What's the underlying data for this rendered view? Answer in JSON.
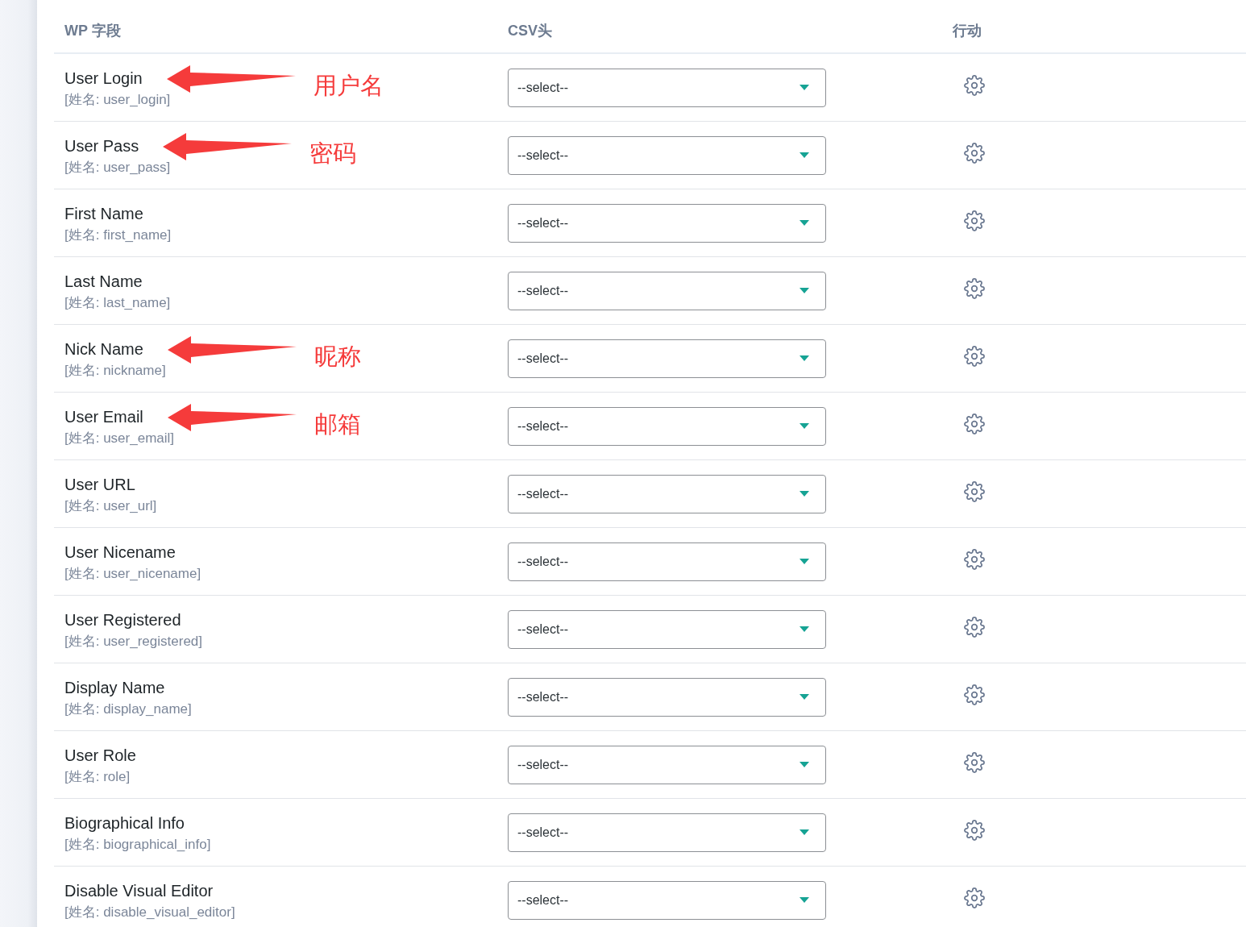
{
  "columns": [
    {
      "label": "WP 字段"
    },
    {
      "label": "CSV头"
    },
    {
      "label": "行动"
    }
  ],
  "rows": [
    {
      "name": "User Login",
      "key": "[姓名: user_login]",
      "csv": {
        "value": "--select--"
      },
      "annotation": "用户名"
    },
    {
      "name": "User Pass",
      "key": "[姓名: user_pass]",
      "csv": {
        "value": "--select--"
      },
      "annotation": "密码"
    },
    {
      "name": "First Name",
      "key": "[姓名: first_name]",
      "csv": {
        "value": "--select--"
      }
    },
    {
      "name": "Last Name",
      "key": "[姓名: last_name]",
      "csv": {
        "value": "--select--"
      }
    },
    {
      "name": "Nick Name",
      "key": "[姓名: nickname]",
      "csv": {
        "value": "--select--"
      },
      "annotation": "昵称"
    },
    {
      "name": "User Email",
      "key": "[姓名: user_email]",
      "csv": {
        "value": "--select--"
      },
      "annotation": "邮箱"
    },
    {
      "name": "User URL",
      "key": "[姓名: user_url]",
      "csv": {
        "value": "--select--"
      }
    },
    {
      "name": "User Nicename",
      "key": "[姓名: user_nicename]",
      "csv": {
        "value": "--select--"
      }
    },
    {
      "name": "User Registered",
      "key": "[姓名: user_registered]",
      "csv": {
        "value": "--select--"
      }
    },
    {
      "name": "Display Name",
      "key": "[姓名: display_name]",
      "csv": {
        "value": "--select--"
      }
    },
    {
      "name": "User Role",
      "key": "[姓名: role]",
      "csv": {
        "value": "--select--"
      }
    },
    {
      "name": "Biographical Info",
      "key": "[姓名: biographical_info]",
      "csv": {
        "value": "--select--"
      }
    },
    {
      "name": "Disable Visual Editor",
      "key": "[姓名: disable_visual_editor]",
      "csv": {
        "value": "--select--"
      }
    }
  ]
}
